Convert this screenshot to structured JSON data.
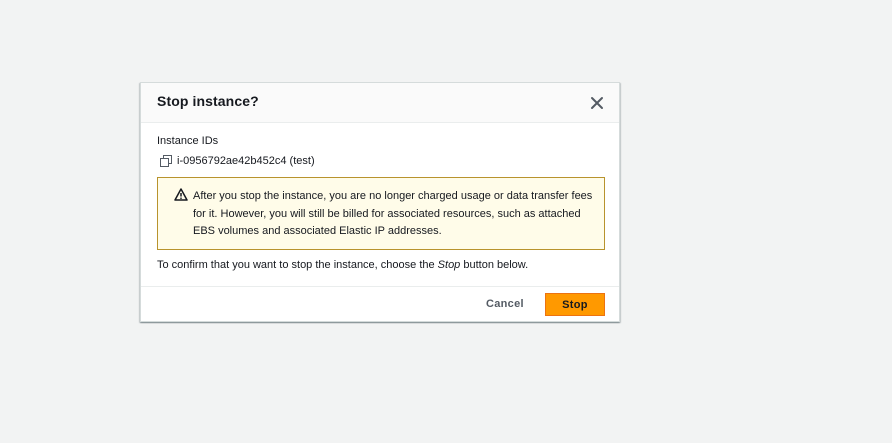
{
  "dialog": {
    "title": "Stop instance?",
    "instance_ids_label": "Instance IDs",
    "instance_id": "i-0956792ae42b452c4 (test)",
    "warning": "After you stop the instance, you are no longer charged usage or data transfer fees for it. However, you will still be billed for associated resources, such as attached EBS volumes and associated Elastic IP addresses.",
    "confirm_prefix": "To confirm that you want to stop the instance, choose the ",
    "confirm_action": "Stop",
    "confirm_suffix": " button below.",
    "cancel_label": "Cancel",
    "stop_label": "Stop"
  },
  "colors": {
    "primary_button": "#ff9900",
    "warning_background": "#fffce9",
    "warning_border": "#b8932d",
    "page_background": "#f2f3f3"
  },
  "icons": {
    "close": "close-icon",
    "copy": "copy-icon",
    "warning": "warning-icon"
  }
}
